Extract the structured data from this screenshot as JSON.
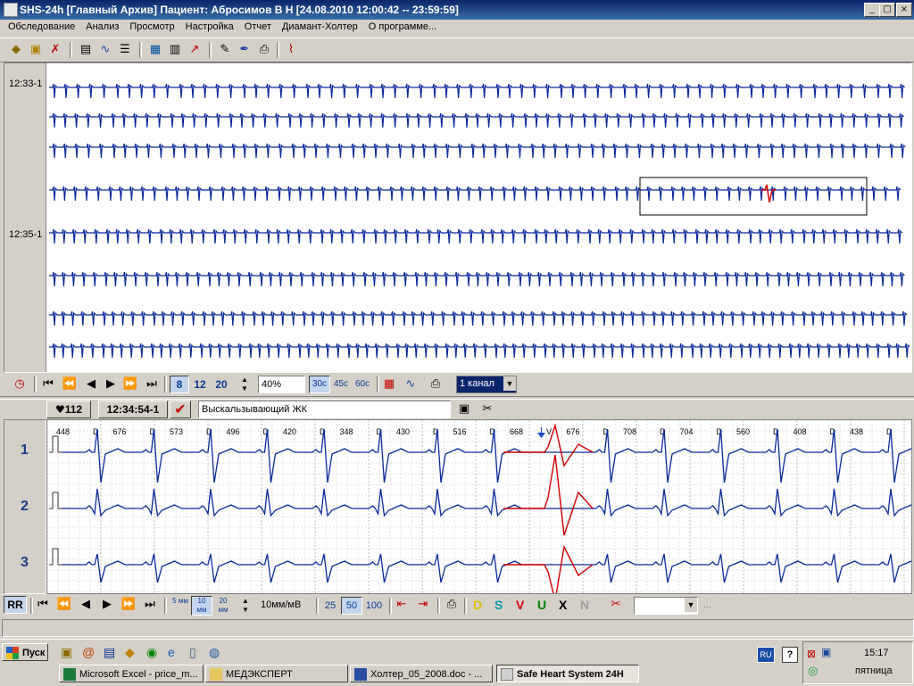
{
  "window": {
    "title": "SHS-24h [Главный Архив] Пациент: Абросимов В Н [24.08.2010 12:00:42 -- 23:59:59]"
  },
  "menu": [
    "Обследование",
    "Анализ",
    "Просмотр",
    "Настройка",
    "Отчет",
    "Диамант-Холтер",
    "О программе..."
  ],
  "strip": {
    "times": [
      "12:33-1",
      "12:35-1"
    ]
  },
  "midtoolbar": {
    "speeds": [
      "8",
      "12",
      "20"
    ],
    "zoom_value": "40%",
    "durations": [
      "30с",
      "45с",
      "60с"
    ],
    "channel_select": "1 канал"
  },
  "event": {
    "heart_rate": "112",
    "time": "12:34:54-1",
    "description": "Выскальзывающий ЖК"
  },
  "ecg": {
    "leads": [
      "1",
      "2",
      "3"
    ],
    "rr": [
      {
        "value": "448",
        "tag": "D"
      },
      {
        "value": "676",
        "tag": "D"
      },
      {
        "value": "573",
        "tag": "D"
      },
      {
        "value": "496",
        "tag": "D"
      },
      {
        "value": "420",
        "tag": "D"
      },
      {
        "value": "348",
        "tag": "D"
      },
      {
        "value": "430",
        "tag": "D"
      },
      {
        "value": "516",
        "tag": "D"
      },
      {
        "value": "668",
        "tag": "V"
      },
      {
        "value": "676",
        "tag": "D"
      },
      {
        "value": "708",
        "tag": "D"
      },
      {
        "value": "704",
        "tag": "D"
      },
      {
        "value": "560",
        "tag": "D"
      },
      {
        "value": "408",
        "tag": "D"
      },
      {
        "value": "438",
        "tag": "D"
      }
    ]
  },
  "bottomtoolbar": {
    "rr_label": "RR",
    "gain_buttons": [
      "5 мм",
      "10 мм",
      "20 мм"
    ],
    "gain_value": "10мм/мВ",
    "speed_buttons": [
      "25",
      "50",
      "100"
    ],
    "class_letters": [
      {
        "letter": "D",
        "color": "#e0c000"
      },
      {
        "letter": "S",
        "color": "#00a0b0"
      },
      {
        "letter": "V",
        "color": "#d00000"
      },
      {
        "letter": "U",
        "color": "#008000"
      },
      {
        "letter": "X",
        "color": "#000000"
      },
      {
        "letter": "N",
        "color": "#a0a0a0"
      }
    ],
    "ellipsis": "..."
  },
  "taskbar": {
    "start": "Пуск",
    "tasks": [
      {
        "label": "Microsoft Excel - price_m...",
        "active": false
      },
      {
        "label": "МЕДЭКСПЕРТ",
        "active": false
      },
      {
        "label": "Холтер_05_2008.doc - ...",
        "active": false
      },
      {
        "label": "Safe Heart System 24H",
        "active": true
      }
    ],
    "lang": "RU",
    "clock": "15:17",
    "day": "пятница"
  },
  "colors": {
    "ecg_normal": "#0a2a9a",
    "ecg_highlight": "#d00000",
    "titlebar": "#0a246a"
  }
}
